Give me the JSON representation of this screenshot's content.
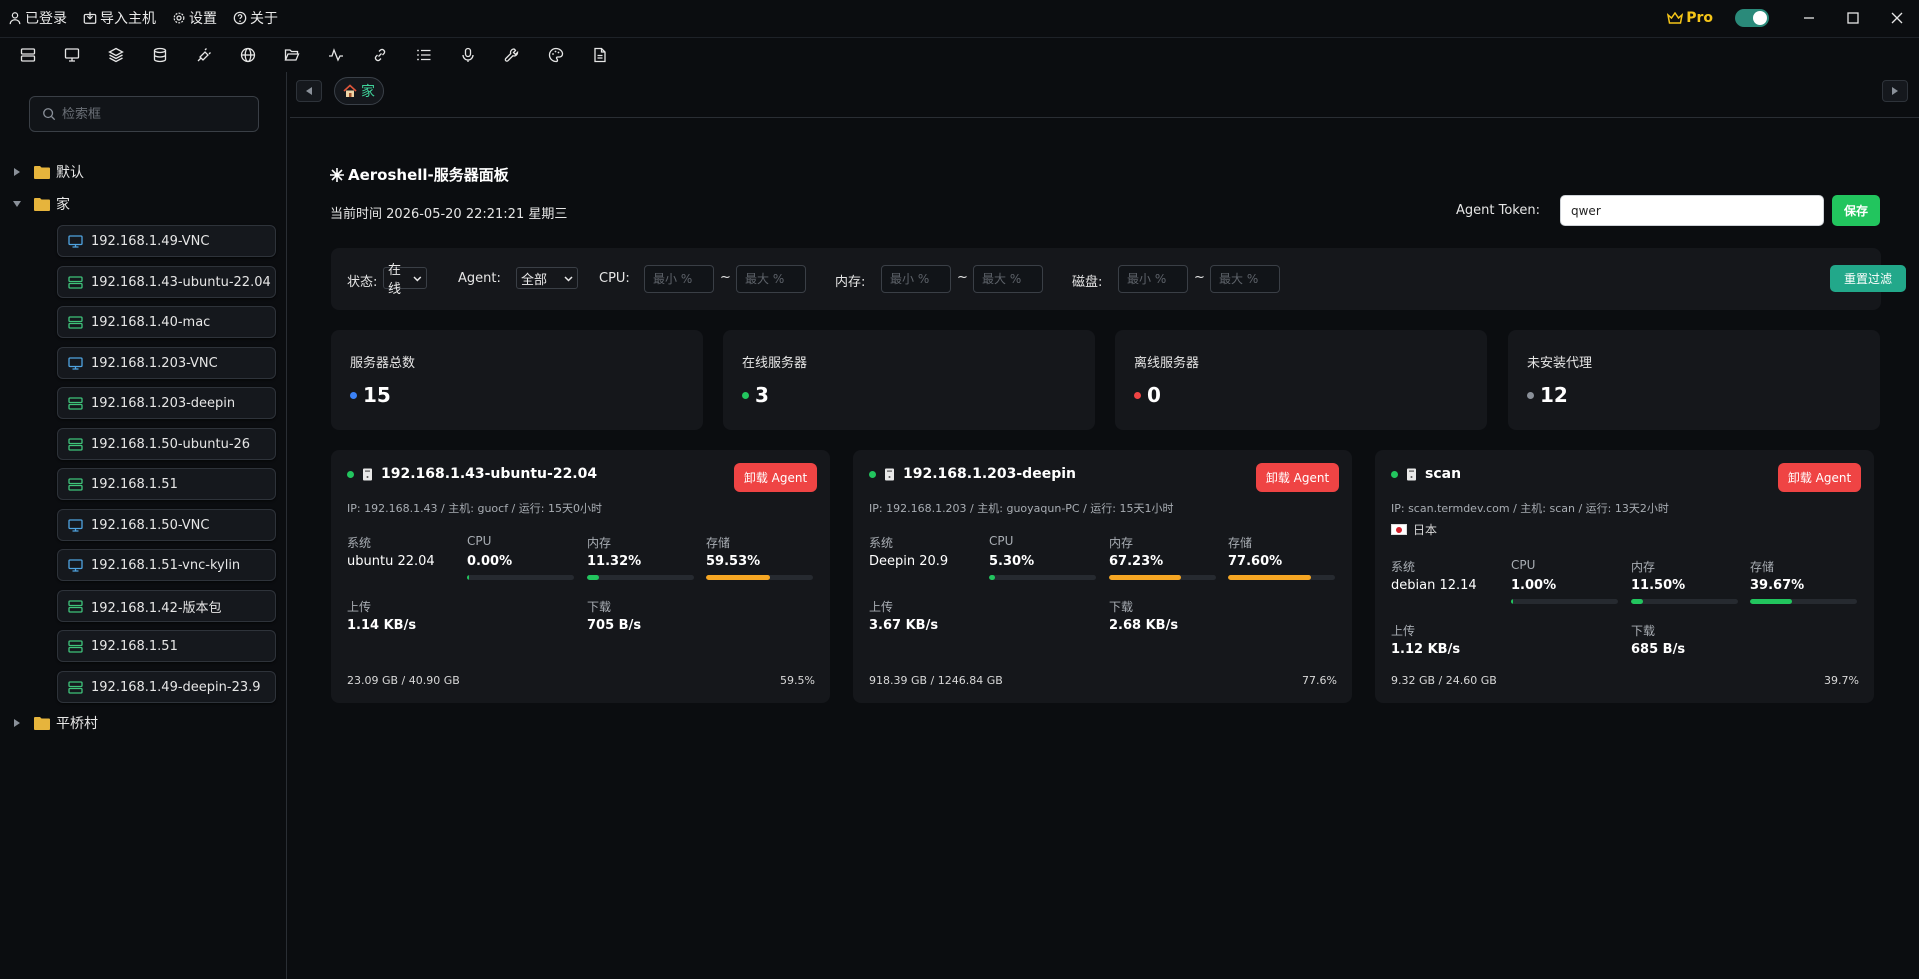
{
  "menu": {
    "login": "已登录",
    "import": "导入主机",
    "settings": "设置",
    "about": "关于",
    "pro": "Pro"
  },
  "colors": {
    "accent_green": "#22c55e",
    "teal": "#22a88a",
    "danger": "#ef4444",
    "warning": "#f5a623",
    "online_dot": "#22c55e",
    "total_dot": "#3b82f6",
    "offline_dot": "#ef4444",
    "noagent_dot": "#8a9099"
  },
  "toolbar": {
    "icons": [
      "server-list-icon",
      "monitor-icon",
      "layers-icon",
      "database-icon",
      "plug-icon",
      "globe-icon",
      "folder-open-icon",
      "activity-icon",
      "link-icon",
      "list-icon",
      "microphone-icon",
      "wrench-icon",
      "palette-icon",
      "document-icon"
    ]
  },
  "sidebar": {
    "search_placeholder": "检索框",
    "groups": [
      {
        "label": "默认",
        "expanded": false
      },
      {
        "label": "家",
        "expanded": true
      },
      {
        "label": "平桥村",
        "expanded": false
      }
    ],
    "hosts": [
      {
        "label": "192.168.1.49-VNC",
        "icon": "monitor-icon"
      },
      {
        "label": "192.168.1.43-ubuntu-22.04",
        "icon": "server-icon"
      },
      {
        "label": "192.168.1.40-mac",
        "icon": "server-icon"
      },
      {
        "label": "192.168.1.203-VNC",
        "icon": "monitor-icon"
      },
      {
        "label": "192.168.1.203-deepin",
        "icon": "server-icon"
      },
      {
        "label": "192.168.1.50-ubuntu-26",
        "icon": "server-icon"
      },
      {
        "label": "192.168.1.51",
        "icon": "server-icon"
      },
      {
        "label": "192.168.1.50-VNC",
        "icon": "monitor-icon"
      },
      {
        "label": "192.168.1.51-vnc-kylin",
        "icon": "monitor-icon"
      },
      {
        "label": "192.168.1.42-版本包",
        "icon": "server-icon"
      },
      {
        "label": "192.168.1.51",
        "icon": "server-icon"
      },
      {
        "label": "192.168.1.49-deepin-23.9",
        "icon": "server-icon"
      }
    ]
  },
  "tabs": {
    "active": "家"
  },
  "dashboard": {
    "title": "Aeroshell-服务器面板",
    "time_prefix": "当前时间",
    "time_value": "2026-05-20 22:21:21 星期三",
    "token_label": "Agent Token:",
    "token_value": "qwer",
    "save_label": "保存"
  },
  "filters": {
    "status_label": "状态:",
    "status_value": "在线",
    "agent_label": "Agent:",
    "agent_value": "全部",
    "cpu_label": "CPU:",
    "mem_label": "内存:",
    "disk_label": "磁盘:",
    "min_placeholder": "最小 %",
    "max_placeholder": "最大 %",
    "tilde": "~",
    "reset_label": "重置过滤"
  },
  "stats": [
    {
      "label": "服务器总数",
      "value": "15",
      "dot": "#3b82f6"
    },
    {
      "label": "在线服务器",
      "value": "3",
      "dot": "#22c55e"
    },
    {
      "label": "离线服务器",
      "value": "0",
      "dot": "#ef4444"
    },
    {
      "label": "未安装代理",
      "value": "12",
      "dot": "#8a9099"
    }
  ],
  "labels": {
    "system": "系统",
    "cpu": "CPU",
    "memory": "内存",
    "storage": "存储",
    "upload": "上传",
    "download": "下载",
    "uninstall": "卸载 Agent"
  },
  "servers": [
    {
      "name": "192.168.1.43-ubuntu-22.04",
      "info": "IP: 192.168.1.43 / 主机: guocf / 运行: 15天0小时",
      "location": "",
      "system": "ubuntu 22.04",
      "cpu": "0.00%",
      "cpu_pct": 0.5,
      "memory": "11.32%",
      "memory_pct": 11.32,
      "storage": "59.53%",
      "storage_pct": 59.53,
      "upload": "1.14 KB/s",
      "download": "705 B/s",
      "disk_usage": "23.09 GB / 40.90 GB",
      "disk_pct": "59.5%"
    },
    {
      "name": "192.168.1.203-deepin",
      "info": "IP: 192.168.1.203 / 主机: guoyaqun-PC / 运行: 15天1小时",
      "location": "",
      "system": "Deepin 20.9",
      "cpu": "5.30%",
      "cpu_pct": 5.3,
      "memory": "67.23%",
      "memory_pct": 67.23,
      "storage": "77.60%",
      "storage_pct": 77.6,
      "upload": "3.67 KB/s",
      "download": "2.68 KB/s",
      "disk_usage": "918.39 GB / 1246.84 GB",
      "disk_pct": "77.6%"
    },
    {
      "name": "scan",
      "info": "IP: scan.termdev.com / 主机: scan / 运行: 13天2小时",
      "location": "日本",
      "system": "debian 12.14",
      "cpu": "1.00%",
      "cpu_pct": 1,
      "memory": "11.50%",
      "memory_pct": 11.5,
      "storage": "39.67%",
      "storage_pct": 39.67,
      "upload": "1.12 KB/s",
      "download": "685 B/s",
      "disk_usage": "9.32 GB / 24.60 GB",
      "disk_pct": "39.7%"
    }
  ]
}
